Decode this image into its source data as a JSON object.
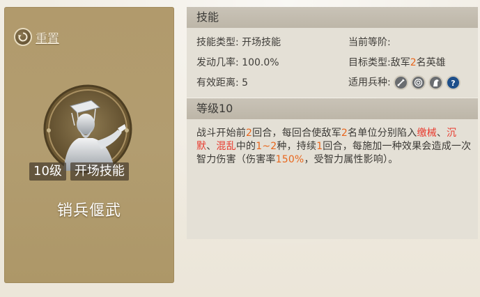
{
  "reset": {
    "label": "重置"
  },
  "hero": {
    "level_badge": "10级",
    "type_badge": "开场技能",
    "skill_name": "销兵偃武"
  },
  "skill_panel": {
    "title": "技能",
    "skill_type": {
      "label": "技能类型:",
      "value": "开场技能"
    },
    "current_tier": {
      "label": "当前等阶:",
      "value": ""
    },
    "trigger_rate": {
      "label": "发动几率:",
      "value": "100.0%"
    },
    "target_type": {
      "label": "目标类型:",
      "prefix": "敌军",
      "count": "2",
      "suffix": "名英雄"
    },
    "range": {
      "label": "有效距离:",
      "value": "5"
    },
    "troops": {
      "label": "适用兵种:",
      "icons": [
        "infantry-sword-icon",
        "archer-target-icon",
        "cavalry-horse-icon",
        "siege-unknown-icon"
      ]
    }
  },
  "level_panel": {
    "title": "等级10",
    "description": [
      {
        "t": "战斗开始前",
        "c": ""
      },
      {
        "t": "2",
        "c": "orange"
      },
      {
        "t": "回合，每回合使敌军",
        "c": ""
      },
      {
        "t": "2",
        "c": "orange"
      },
      {
        "t": "名单位分别陷入",
        "c": ""
      },
      {
        "t": "缴械",
        "c": "red"
      },
      {
        "t": "、",
        "c": ""
      },
      {
        "t": "沉默",
        "c": "red"
      },
      {
        "t": "、",
        "c": ""
      },
      {
        "t": "混乱",
        "c": "red"
      },
      {
        "t": "中的",
        "c": ""
      },
      {
        "t": "1~2",
        "c": "orange"
      },
      {
        "t": "种，持续",
        "c": ""
      },
      {
        "t": "1",
        "c": "orange"
      },
      {
        "t": "回合，每施加一种效果会造成一次智力伤害（伤害率",
        "c": ""
      },
      {
        "t": "150%",
        "c": "orange"
      },
      {
        "t": "，受智力属性影响）。",
        "c": ""
      }
    ]
  },
  "colors": {
    "highlight_orange": "#e8661c",
    "status_red": "#e83a2e",
    "card_bg": "#b29d70"
  }
}
